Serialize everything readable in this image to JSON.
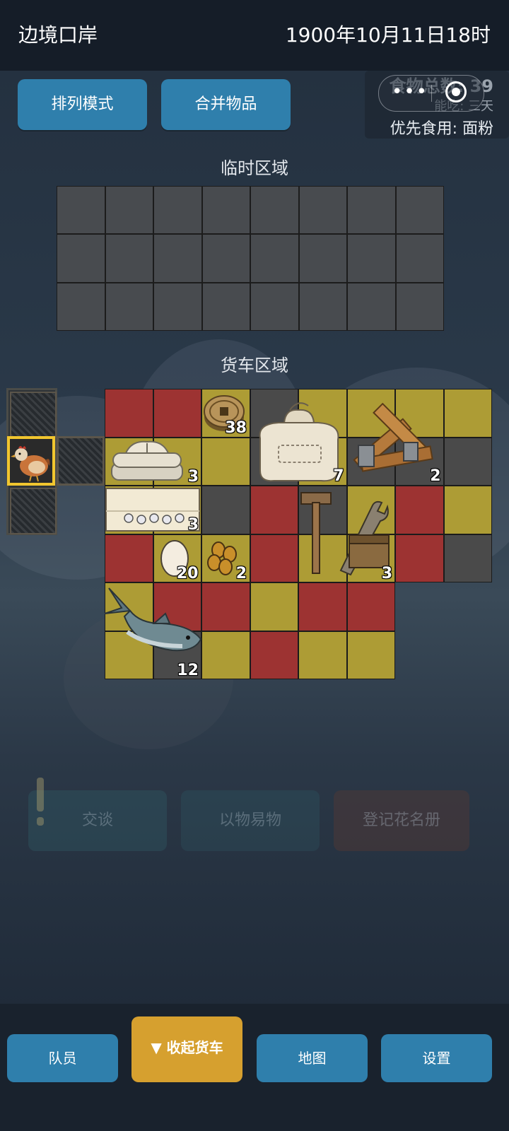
{
  "header": {
    "location": "边境口岸",
    "datetime": "1900年10月11日18时"
  },
  "toolbar": {
    "sort_label": "排列模式",
    "merge_label": "合并物品"
  },
  "food": {
    "total": "食物总数: 39",
    "days": "能吃: 三天",
    "preferred": "优先食用: 面粉"
  },
  "temp_area": {
    "title": "临时区域"
  },
  "cart_area": {
    "title": "货车区域",
    "items": [
      {
        "name": "coin",
        "count": "38"
      },
      {
        "name": "cloth",
        "count": "3"
      },
      {
        "name": "flour-sack",
        "count": "7"
      },
      {
        "name": "wood-planks",
        "count": "2"
      },
      {
        "name": "fabric-buttons",
        "count": "3"
      },
      {
        "name": "egg",
        "count": "20"
      },
      {
        "name": "seeds",
        "count": "2"
      },
      {
        "name": "tools",
        "count": "3"
      },
      {
        "name": "fish",
        "count": "12"
      }
    ]
  },
  "background_actions": {
    "talk": "交谈",
    "barter": "以物易物",
    "register": "登记花名册"
  },
  "nav": {
    "members": "队员",
    "collapse_cart": "▼ 收起货车",
    "map": "地图",
    "settings": "设置"
  },
  "colors": {
    "cell_red": "#9d3332",
    "cell_yellow": "#ad9c35",
    "cell_gray": "#4a4a4a",
    "accent_blue": "#2f7fac",
    "accent_orange": "#d6a02f"
  }
}
